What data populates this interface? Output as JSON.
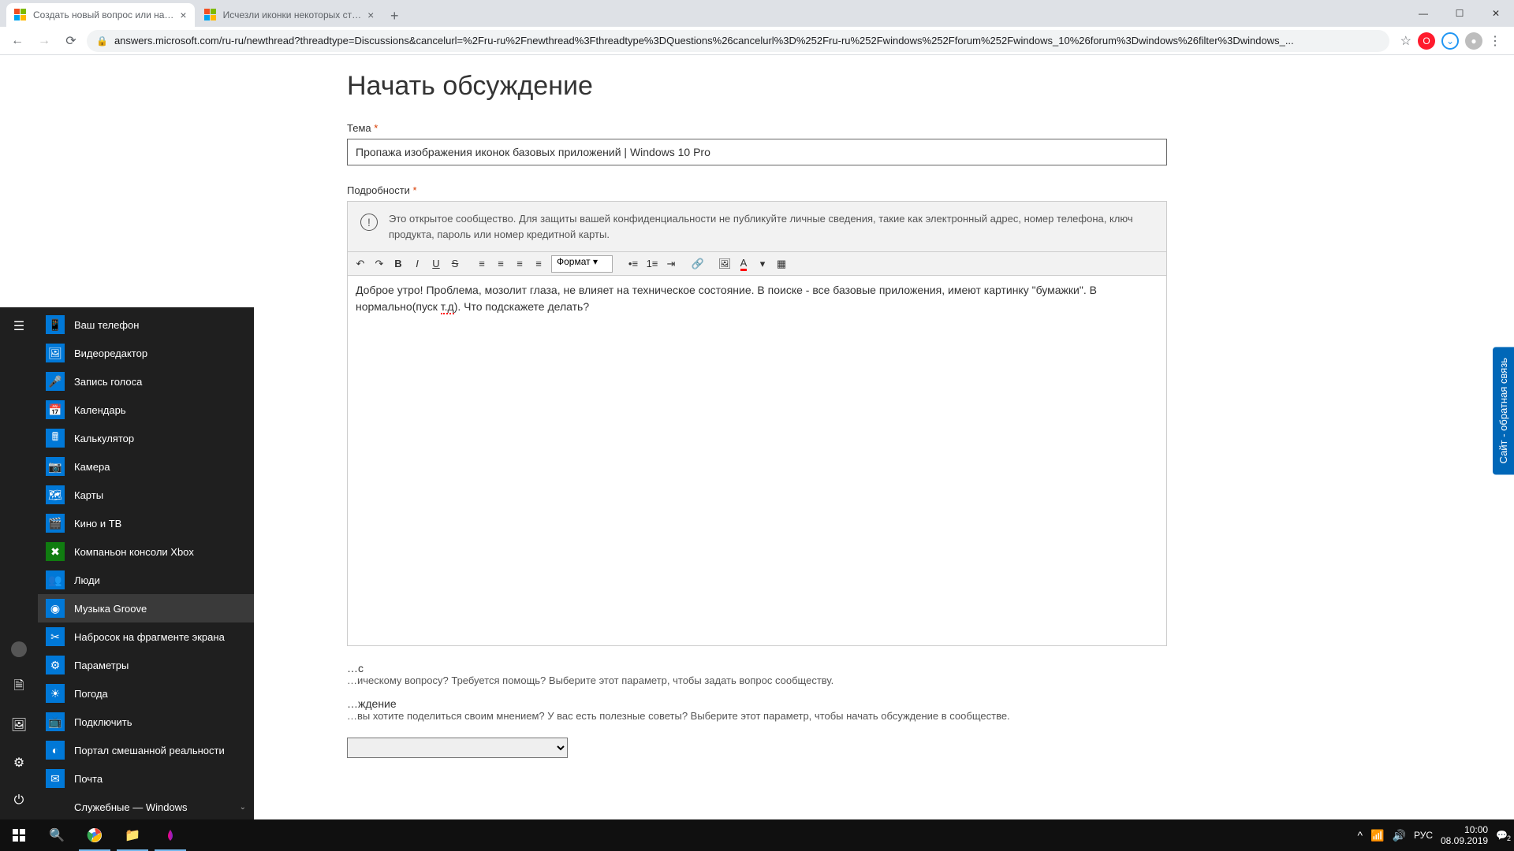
{
  "browser": {
    "tabs": [
      {
        "title": "Создать новый вопрос или на…"
      },
      {
        "title": "Исчезли иконки некоторых ст…"
      }
    ],
    "url": "answers.microsoft.com/ru-ru/newthread?threadtype=Discussions&cancelurl=%2Fru-ru%2Fnewthread%3Fthreadtype%3DQuestions%26cancelurl%3D%252Fru-ru%252Fwindows%252Fforum%252Fwindows_10%26forum%3Dwindows%26filter%3Dwindows_..."
  },
  "page": {
    "heading": "Начать обсуждение",
    "topic_label": "Тема",
    "topic_value": "Пропажа изображения иконок базовых приложений | Windows 10 Pro",
    "details_label": "Подробности",
    "privacy_notice": "Это открытое сообщество. Для защиты вашей конфиденциальности не публикуйте личные сведения, такие как электронный адрес, номер телефона, ключ продукта, пароль или номер кредитной карты.",
    "format_label": "Формат",
    "editor_text_prefix": "Доброе утро! Проблема, мозолит глаза, не влияет на техническое состояние. В поиске - все базовые приложения, имеют картинку \"бумажки\". В                                                                            нормально(пуск ",
    "editor_spell": "т.д",
    "editor_text_suffix": "). Что подскажете делать?",
    "opt1_title": "…с",
    "opt1_desc": "…ическому вопросу? Требуется помощь? Выберите этот параметр, чтобы задать вопрос сообществу.",
    "opt2_title": "…ждение",
    "opt2_desc": "…вы хотите поделиться своим мнением? У вас есть полезные советы? Выберите этот параметр, чтобы начать обсуждение в сообществе.",
    "feedback": "Сайт - обратная связь"
  },
  "start_menu": {
    "apps": [
      {
        "name": "Ваш телефон",
        "color": "#0078d7",
        "glyph": "📱"
      },
      {
        "name": "Видеоредактор",
        "color": "#0078d7",
        "glyph": "🖼"
      },
      {
        "name": "Запись голоса",
        "color": "#0078d7",
        "glyph": "🎤"
      },
      {
        "name": "Календарь",
        "color": "#0078d7",
        "glyph": "📅"
      },
      {
        "name": "Калькулятор",
        "color": "#0078d7",
        "glyph": "🖩"
      },
      {
        "name": "Камера",
        "color": "#0078d7",
        "glyph": "📷"
      },
      {
        "name": "Карты",
        "color": "#0078d7",
        "glyph": "🗺"
      },
      {
        "name": "Кино и ТВ",
        "color": "#0078d7",
        "glyph": "🎬"
      },
      {
        "name": "Компаньон консоли Xbox",
        "color": "#107c10",
        "glyph": "✖"
      },
      {
        "name": "Люди",
        "color": "#0078d7",
        "glyph": "👥"
      },
      {
        "name": "Музыка Groove",
        "color": "#0078d7",
        "glyph": "◉",
        "hover": true
      },
      {
        "name": "Набросок на фрагменте экрана",
        "color": "#0078d7",
        "glyph": "✂"
      },
      {
        "name": "Параметры",
        "color": "#0078d7",
        "glyph": "⚙"
      },
      {
        "name": "Погода",
        "color": "#0078d7",
        "glyph": "☀"
      },
      {
        "name": "Подключить",
        "color": "#0078d7",
        "glyph": "📺"
      },
      {
        "name": "Портал смешанной реальности",
        "color": "#0078d7",
        "glyph": "◐"
      },
      {
        "name": "Почта",
        "color": "#0078d7",
        "glyph": "✉"
      },
      {
        "name": "Служебные — Windows",
        "color": "transparent",
        "glyph": "",
        "expand": true
      }
    ]
  },
  "taskbar": {
    "lang": "РУС",
    "time": "10:00",
    "date": "08.09.2019",
    "notif_count": "2"
  }
}
